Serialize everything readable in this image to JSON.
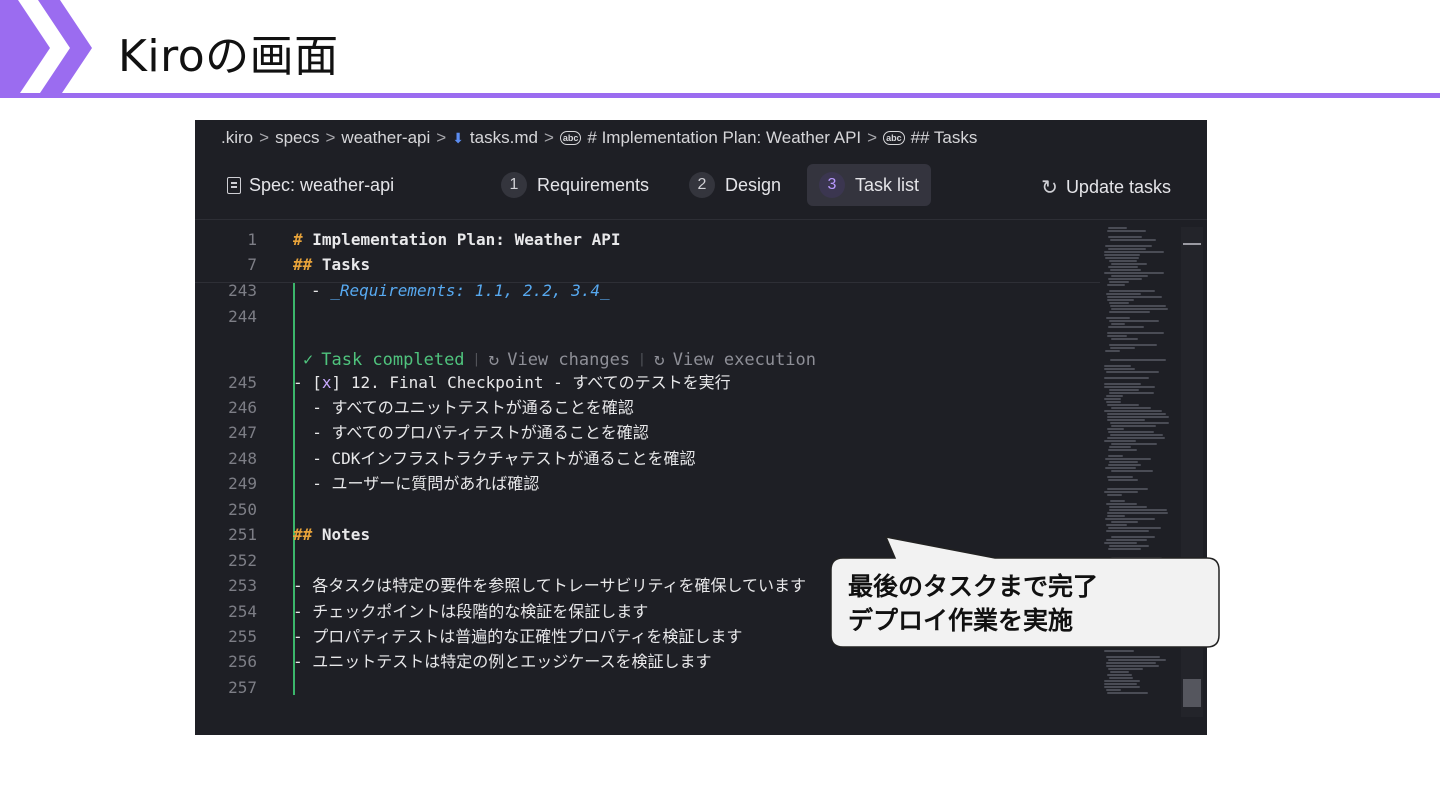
{
  "slide": {
    "title": "Kiroの画面"
  },
  "breadcrumb": {
    "parts": [
      ".kiro",
      "specs",
      "weather-api"
    ],
    "file": "tasks.md",
    "heading1": "# Implementation Plan: Weather API",
    "heading2": "## Tasks",
    "separator": ">"
  },
  "specbar": {
    "spec_label": "Spec: weather-api",
    "steps": [
      {
        "num": "1",
        "label": "Requirements"
      },
      {
        "num": "2",
        "label": "Design"
      },
      {
        "num": "3",
        "label": "Task list"
      }
    ],
    "active_step": "Task list",
    "update_label": "Update tasks"
  },
  "editor": {
    "sticky": [
      {
        "ln": "1",
        "text": "Implementation Plan: Weather API",
        "marker": "#"
      },
      {
        "ln": "7",
        "text": "Tasks",
        "marker": "##"
      }
    ],
    "lines": [
      {
        "ln": "243",
        "text": "  - _Requirements: 1.1, 2.2, 3.4_"
      },
      {
        "ln": "244",
        "text": ""
      },
      {
        "ln": "245",
        "text": "- [x] 12. Final Checkpoint - すべてのテストを実行",
        "check": "x"
      },
      {
        "ln": "246",
        "text": "  - すべてのユニットテストが通ることを確認"
      },
      {
        "ln": "247",
        "text": "  - すべてのプロパティテストが通ることを確認"
      },
      {
        "ln": "248",
        "text": "  - CDKインフラストラクチャテストが通ることを確認"
      },
      {
        "ln": "249",
        "text": "  - ユーザーに質問があれば確認"
      },
      {
        "ln": "250",
        "text": ""
      },
      {
        "ln": "251",
        "text": "## Notes",
        "marker": "##",
        "heading_text": "Notes"
      },
      {
        "ln": "252",
        "text": ""
      },
      {
        "ln": "253",
        "text": "- 各タスクは特定の要件を参照してトレーサビリティを確保しています"
      },
      {
        "ln": "254",
        "text": "- チェックポイントは段階的な検証を保証します"
      },
      {
        "ln": "255",
        "text": "- プロパティテストは普遍的な正確性プロパティを検証します"
      },
      {
        "ln": "256",
        "text": "- ユニットテストは特定の例とエッジケースを検証します"
      },
      {
        "ln": "257",
        "text": ""
      }
    ],
    "codelens": {
      "status": "Task completed",
      "view_changes": "View changes",
      "view_execution": "View execution"
    }
  },
  "callout": {
    "line1": "最後のタスクまで完了",
    "line2": "デプロイ作業を実施"
  },
  "colors": {
    "accent_purple": "#9b6cf0",
    "ide_bg": "#1e1f25",
    "completed_green": "#4fc37d",
    "heading_orange": "#e8a33a",
    "requirements_blue": "#57a9f0"
  }
}
